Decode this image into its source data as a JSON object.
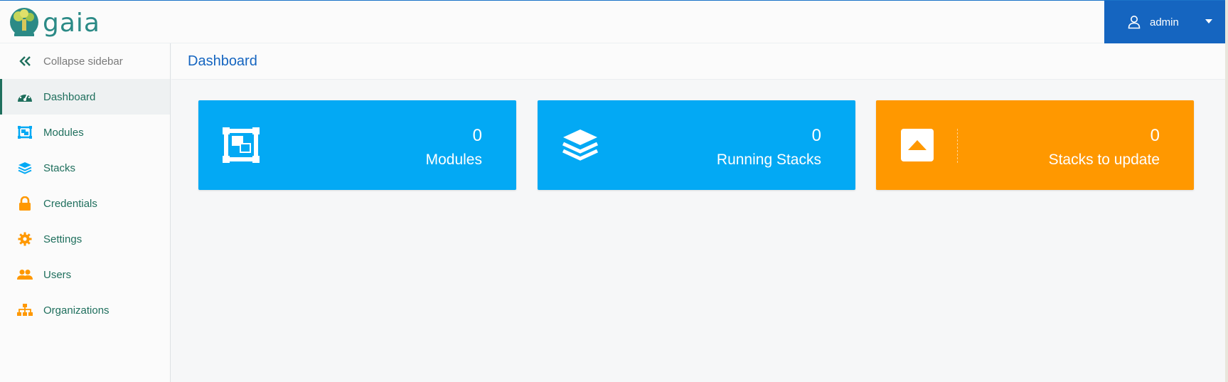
{
  "app": {
    "name": "gaia"
  },
  "user": {
    "name": "admin"
  },
  "sidebar": {
    "collapse_label": "Collapse sidebar",
    "items": [
      {
        "label": "Dashboard",
        "icon": "dashboard-gauge-icon",
        "active": true
      },
      {
        "label": "Modules",
        "icon": "modules-icon"
      },
      {
        "label": "Stacks",
        "icon": "layers-icon"
      },
      {
        "label": "Credentials",
        "icon": "lock-icon"
      },
      {
        "label": "Settings",
        "icon": "gear-icon"
      },
      {
        "label": "Users",
        "icon": "users-icon"
      },
      {
        "label": "Organizations",
        "icon": "sitemap-icon"
      }
    ]
  },
  "page": {
    "title": "Dashboard"
  },
  "cards": [
    {
      "value": "0",
      "label": "Modules",
      "icon": "modules-icon",
      "color": "#03a9f4"
    },
    {
      "value": "0",
      "label": "Running Stacks",
      "icon": "layers-icon",
      "color": "#03a9f4"
    },
    {
      "value": "0",
      "label": "Stacks to update",
      "icon": "caret-up-square-icon",
      "color": "#ff9800"
    }
  ],
  "colors": {
    "primary": "#1565c0",
    "accent_teal": "#1f6f5d",
    "icon_orange": "#ff9800",
    "icon_blue": "#03a9f4"
  }
}
